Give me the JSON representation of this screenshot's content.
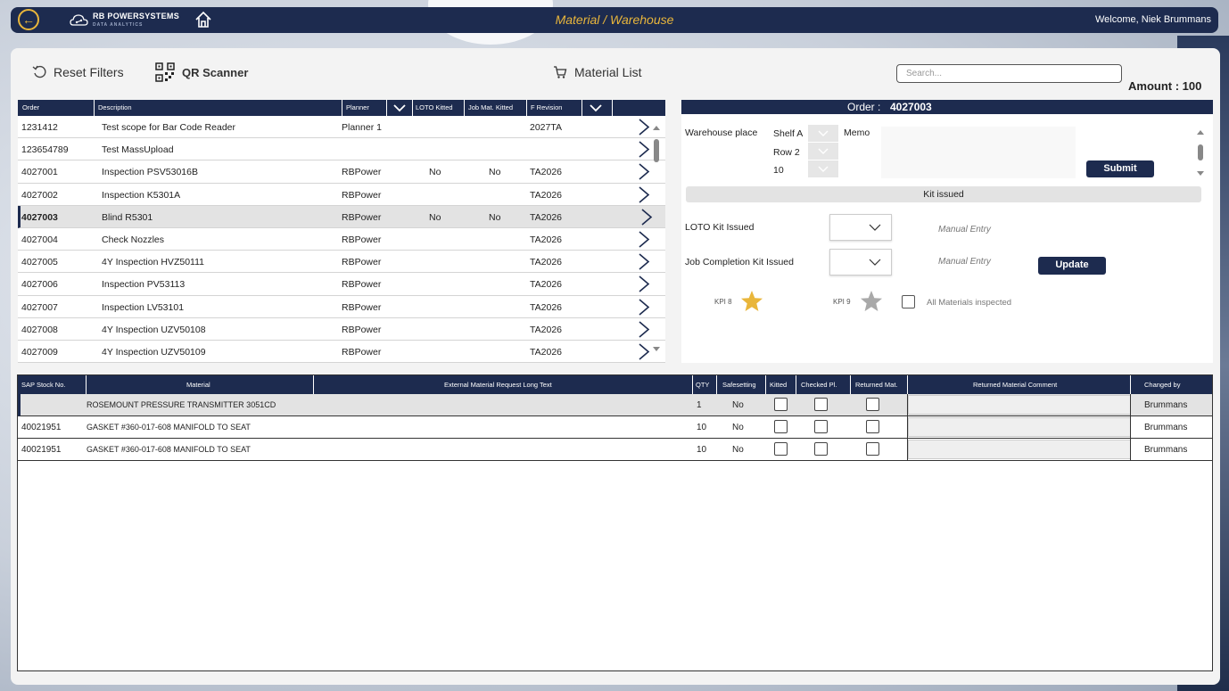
{
  "header": {
    "back_icon": "back-arrow-icon",
    "logo_text": "RB POWERSYSTEMS",
    "logo_sub": "DATA ANALYTICS",
    "home_icon": "home-icon",
    "title": "Material / Warehouse",
    "welcome": "Welcome, Niek Brummans"
  },
  "toolbar": {
    "reset_label": "Reset Filters",
    "qr_label": "QR Scanner",
    "material_list_label": "Material List",
    "search_placeholder": "Search...",
    "amount_label": "Amount :",
    "amount_value": "100"
  },
  "orders": {
    "columns": [
      "Order",
      "Description",
      "Planner",
      "LOTO Kitted",
      "Job Mat. Kitted",
      "F Revision"
    ],
    "rows": [
      {
        "order": "1231412",
        "description": "Test scope for Bar Code Reader",
        "planner": "Planner 1",
        "loto": "",
        "job": "",
        "rev": "2027TA"
      },
      {
        "order": "123654789",
        "description": "Test MassUpload",
        "planner": "",
        "loto": "",
        "job": "",
        "rev": ""
      },
      {
        "order": "4027001",
        "description": "Inspection PSV53016B",
        "planner": "RBPower",
        "loto": "No",
        "job": "No",
        "rev": "TA2026"
      },
      {
        "order": "4027002",
        "description": "Inspection K5301A",
        "planner": "RBPower",
        "loto": "",
        "job": "",
        "rev": "TA2026"
      },
      {
        "order": "4027003",
        "description": "Blind R5301",
        "planner": "RBPower",
        "loto": "No",
        "job": "No",
        "rev": "TA2026"
      },
      {
        "order": "4027004",
        "description": "Check Nozzles",
        "planner": "RBPower",
        "loto": "",
        "job": "",
        "rev": "TA2026"
      },
      {
        "order": "4027005",
        "description": "4Y Inspection HVZ50111",
        "planner": "RBPower",
        "loto": "",
        "job": "",
        "rev": "TA2026"
      },
      {
        "order": "4027006",
        "description": "Inspection PV53113",
        "planner": "RBPower",
        "loto": "",
        "job": "",
        "rev": "TA2026"
      },
      {
        "order": "4027007",
        "description": "Inspection LV53101",
        "planner": "RBPower",
        "loto": "",
        "job": "",
        "rev": "TA2026"
      },
      {
        "order": "4027008",
        "description": "4Y Inspection UZV50108",
        "planner": "RBPower",
        "loto": "",
        "job": "",
        "rev": "TA2026"
      },
      {
        "order": "4027009",
        "description": "4Y Inspection UZV50109",
        "planner": "RBPower",
        "loto": "",
        "job": "",
        "rev": "TA2026"
      }
    ]
  },
  "detail": {
    "order_label": "Order :",
    "order_value": "4027003",
    "warehouse_label": "Warehouse place",
    "shelf": "Shelf A",
    "row": "Row 2",
    "level": "10",
    "memo_label": "Memo",
    "submit_label": "Submit",
    "kit_issued_label": "Kit issued",
    "loto_label": "LOTO Kit Issued",
    "job_label": "Job Completion Kit Issued",
    "manual_entry": "Manual Entry",
    "update_label": "Update",
    "kpi8_label": "KPI 8",
    "kpi9_label": "KPI 9",
    "all_inspected_label": "All Materials inspected",
    "star_gold": "#e9b63b",
    "star_gray": "#a9a9a9"
  },
  "materials": {
    "columns": [
      "SAP Stock No.",
      "Material",
      "External Material Request Long Text",
      "QTY",
      "Safesetting",
      "Kitted",
      "Checked Pl.",
      "Returned Mat.",
      "Returned Material Comment",
      "Changed by"
    ],
    "rows": [
      {
        "sap": "",
        "material": "ROSEMOUNT PRESSURE TRANSMITTER 3051CD",
        "qty": "1",
        "safe": "No",
        "changed": "Brummans"
      },
      {
        "sap": "40021951",
        "material": "GASKET #360-017-608  MANIFOLD TO SEAT",
        "qty": "10",
        "safe": "No",
        "changed": "Brummans"
      },
      {
        "sap": "40021951",
        "material": "GASKET #360-017-608  MANIFOLD TO SEAT",
        "qty": "10",
        "safe": "No",
        "changed": "Brummans"
      }
    ]
  },
  "colors": {
    "navy": "#1d2b4f",
    "accent": "#e9b63b"
  }
}
